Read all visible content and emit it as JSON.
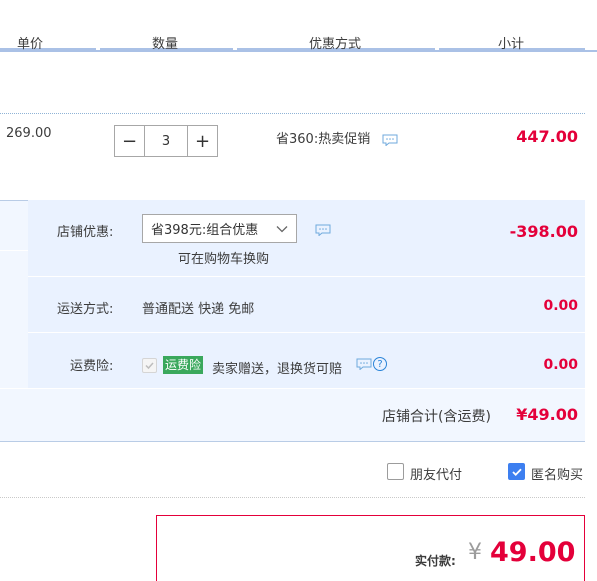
{
  "header": {
    "col_price": "单价",
    "col_qty": "数量",
    "col_promo": "优惠方式",
    "col_subtotal": "小计"
  },
  "item": {
    "price": "269.00",
    "qty_minus": "−",
    "qty_value": "3",
    "qty_plus": "+",
    "promo": "省360:热卖促销",
    "subtotal": "447.00"
  },
  "shop": {
    "discount_label": "店铺优惠:",
    "discount_select": "省398元:组合优惠",
    "discount_hint": "可在购物车换购",
    "discount_amount": "-398.00",
    "shipping_label": "运送方式:",
    "shipping_value": "普通配送 快递 免邮",
    "shipping_amount": "0.00",
    "insurance_label": "运费险:",
    "insurance_badge": "运费险",
    "insurance_text": "卖家赠送，退换货可赔",
    "insurance_help": "?",
    "insurance_amount": "0.00",
    "total_label": "店铺合计(含运费)",
    "total_amount": "¥49.00"
  },
  "options": {
    "friend_pay": "朋友代付",
    "anonymous": "匿名购买"
  },
  "payment": {
    "label": "实付款:",
    "currency": "¥",
    "amount": "49.00"
  },
  "colors": {
    "accent_red": "#e4003a",
    "header_line": "#aac1e6",
    "shop_bg": "#f2f7ff",
    "badge_green": "#3aa85c",
    "checkbox_blue": "#3d7ff0"
  }
}
